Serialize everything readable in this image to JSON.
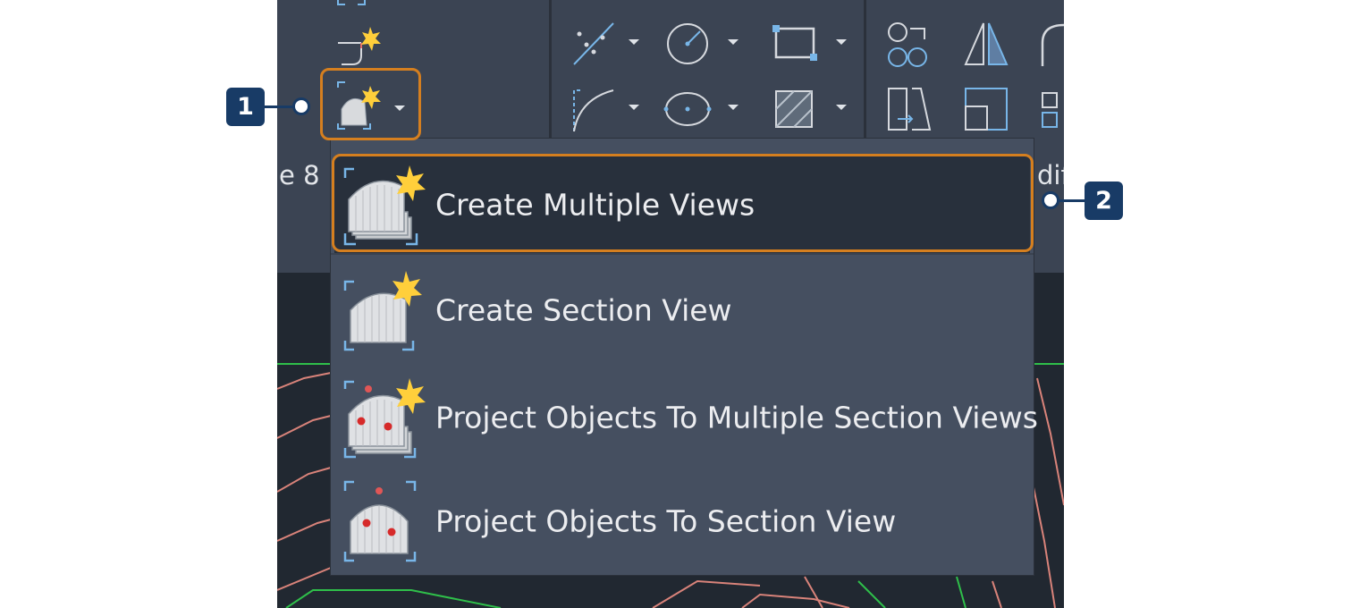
{
  "ribbon": {
    "panel_labels": {
      "left_fragment": "le 8",
      "right_fragment": "dif"
    },
    "create_views_button": {
      "icon": "section-view-star-icon",
      "has_dropdown": true
    }
  },
  "dropdown_menu": {
    "items": [
      {
        "label": "Create Multiple Views",
        "icon": "multiple-section-views-icon",
        "active": true
      },
      {
        "label": "Create Section View",
        "icon": "section-view-icon",
        "active": false
      },
      {
        "label": "Project Objects To Multiple Section Views",
        "icon": "project-multiple-section-views-icon",
        "active": false
      },
      {
        "label": "Project Objects To Section View",
        "icon": "project-section-view-icon",
        "active": false
      }
    ]
  },
  "callouts": [
    {
      "number": "1",
      "target": "create-views-dropdown-button"
    },
    {
      "number": "2",
      "target": "menu-item-create-multiple-views"
    }
  ],
  "colors": {
    "highlight": "#d57f1f",
    "callout": "#183b66",
    "ribbon_bg": "#3b4453",
    "menu_bg": "#454f60",
    "menu_active_bg": "#28303c",
    "icon_accent": "#78b6e8",
    "star": "#ffcf3b"
  }
}
